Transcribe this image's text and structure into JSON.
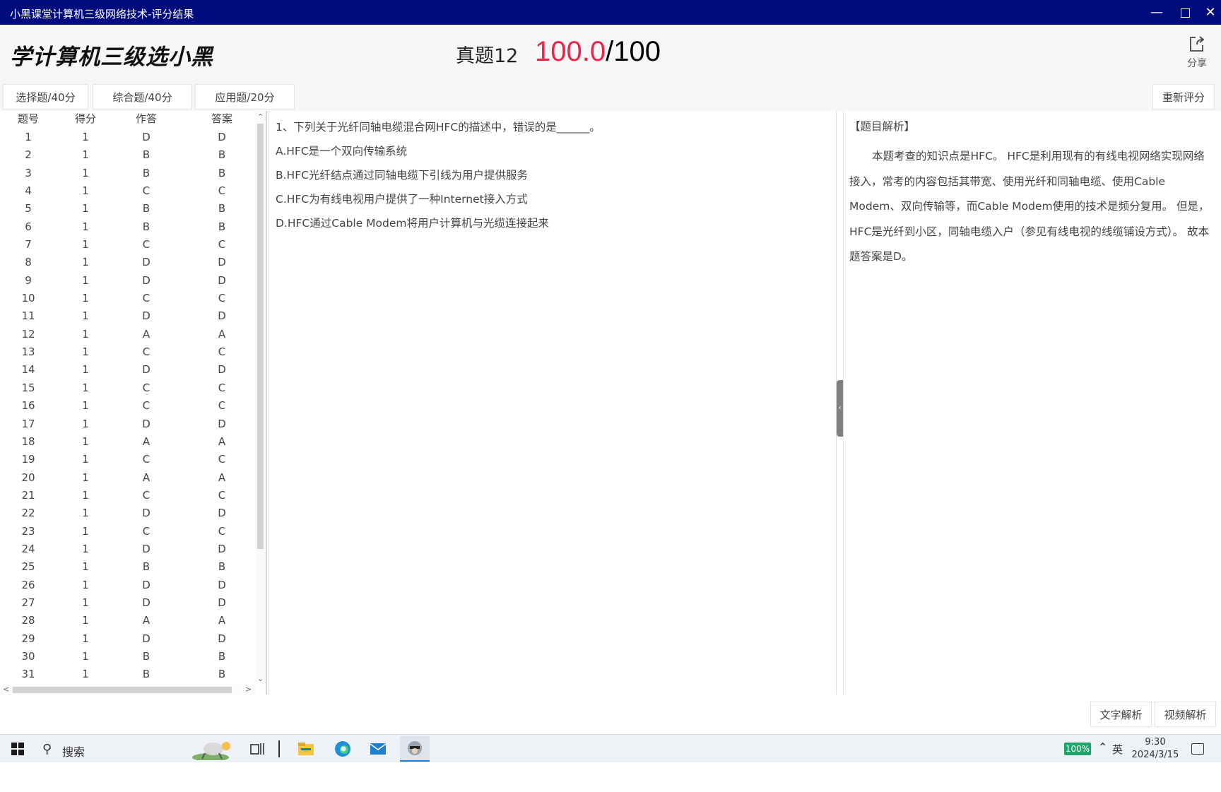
{
  "window": {
    "title": "小黑课堂计算机三级网络技术-评分结果"
  },
  "header": {
    "logo": "学计算机三级选小黑",
    "exam_name": "真题12",
    "score_got": "100.0",
    "score_total": "/100",
    "share_label": "分享"
  },
  "tabs": [
    "选择题/40分",
    "综合题/40分",
    "应用题/20分"
  ],
  "regrade_label": "重新评分",
  "table": {
    "headers": [
      "题号",
      "得分",
      "作答",
      "答案"
    ],
    "rows": [
      [
        "1",
        "1",
        "D",
        "D"
      ],
      [
        "2",
        "1",
        "B",
        "B"
      ],
      [
        "3",
        "1",
        "B",
        "B"
      ],
      [
        "4",
        "1",
        "C",
        "C"
      ],
      [
        "5",
        "1",
        "B",
        "B"
      ],
      [
        "6",
        "1",
        "B",
        "B"
      ],
      [
        "7",
        "1",
        "C",
        "C"
      ],
      [
        "8",
        "1",
        "D",
        "D"
      ],
      [
        "9",
        "1",
        "D",
        "D"
      ],
      [
        "10",
        "1",
        "C",
        "C"
      ],
      [
        "11",
        "1",
        "D",
        "D"
      ],
      [
        "12",
        "1",
        "A",
        "A"
      ],
      [
        "13",
        "1",
        "C",
        "C"
      ],
      [
        "14",
        "1",
        "D",
        "D"
      ],
      [
        "15",
        "1",
        "C",
        "C"
      ],
      [
        "16",
        "1",
        "C",
        "C"
      ],
      [
        "17",
        "1",
        "D",
        "D"
      ],
      [
        "18",
        "1",
        "A",
        "A"
      ],
      [
        "19",
        "1",
        "C",
        "C"
      ],
      [
        "20",
        "1",
        "A",
        "A"
      ],
      [
        "21",
        "1",
        "C",
        "C"
      ],
      [
        "22",
        "1",
        "D",
        "D"
      ],
      [
        "23",
        "1",
        "C",
        "C"
      ],
      [
        "24",
        "1",
        "D",
        "D"
      ],
      [
        "25",
        "1",
        "B",
        "B"
      ],
      [
        "26",
        "1",
        "D",
        "D"
      ],
      [
        "27",
        "1",
        "D",
        "D"
      ],
      [
        "28",
        "1",
        "A",
        "A"
      ],
      [
        "29",
        "1",
        "D",
        "D"
      ],
      [
        "30",
        "1",
        "B",
        "B"
      ],
      [
        "31",
        "1",
        "B",
        "B"
      ]
    ]
  },
  "question": {
    "stem": "1、下列关于光纤同轴电缆混合网HFC的描述中，错误的是______。",
    "options": [
      "A.HFC是一个双向传输系统",
      "B.HFC光纤结点通过同轴电缆下引线为用户提供服务",
      "C.HFC为有线电视用户提供了一种Internet接入方式",
      "D.HFC通过Cable Modem将用户计算机与光缆连接起来"
    ]
  },
  "analysis": {
    "title": "【题目解析】",
    "text": "本题考查的知识点是HFC。 HFC是利用现有的有线电视网络实现网络接入，常考的内容包括其带宽、使用光纤和同轴电缆、使用Cable Modem、双向传输等，而Cable Modem使用的技术是频分复用。 但是，HFC是光纤到小区，同轴电缆入户（参见有线电视的线缆铺设方式）。 故本题答案是D。"
  },
  "bottom": {
    "text_analysis": "文字解析",
    "video_analysis": "视频解析"
  },
  "taskbar": {
    "search_placeholder": "搜索",
    "battery": "100%",
    "ime": "英",
    "time": "9:30",
    "date": "2024/3/15"
  }
}
